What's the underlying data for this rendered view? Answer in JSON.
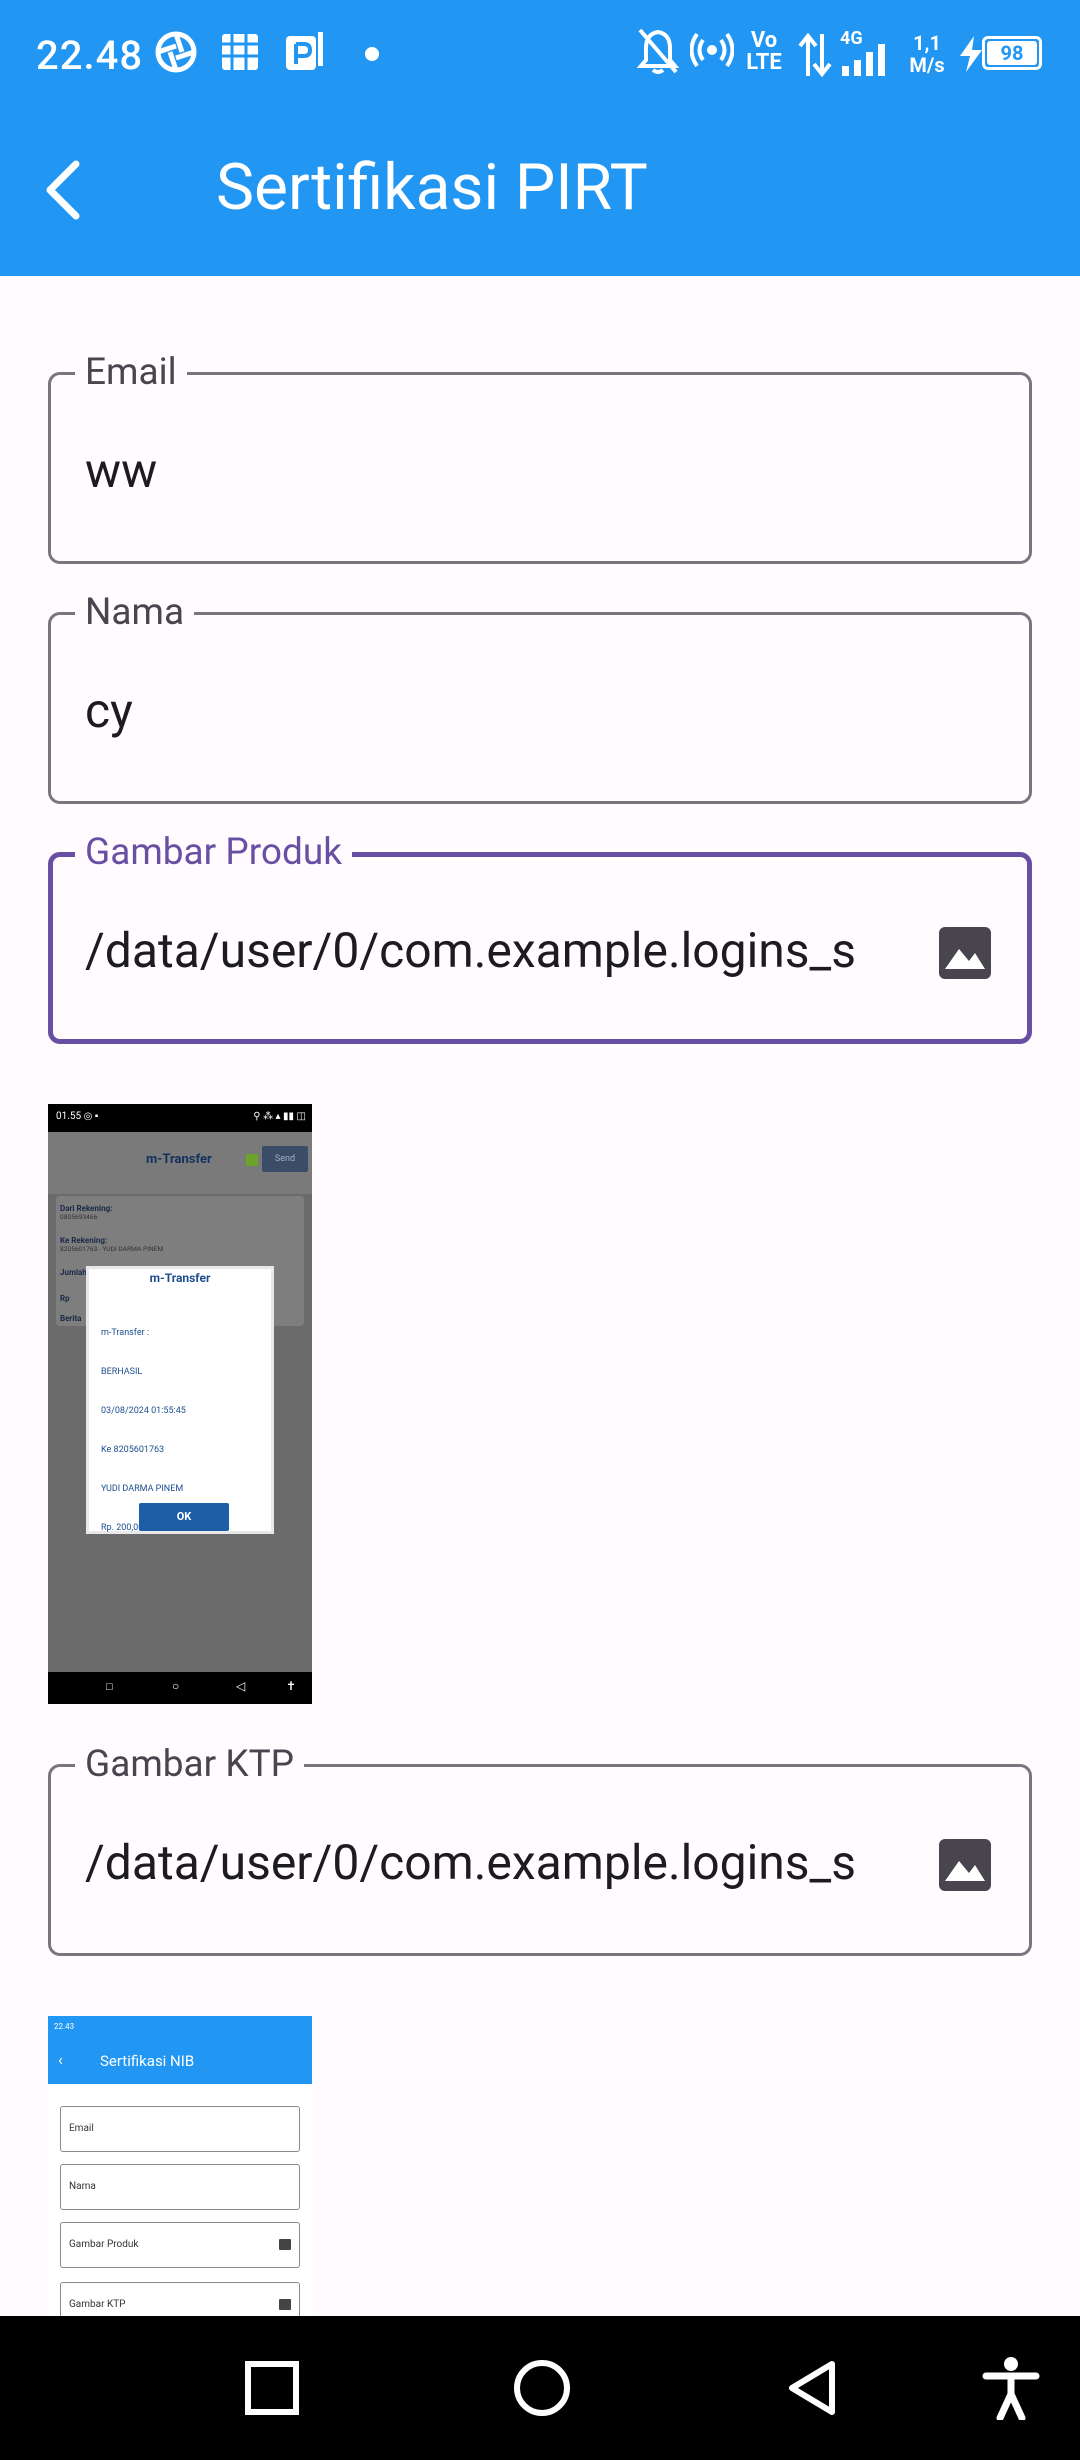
{
  "status_bar": {
    "time": "22.48",
    "icons": [
      "aperture-icon",
      "chip-icon",
      "parking-icon",
      "dot-icon",
      "bell-off-icon",
      "hotspot-icon",
      "volte-icon",
      "data-arrows-icon",
      "signal-4g-icon"
    ],
    "network_type": "4G",
    "speed": "1,1",
    "speed_unit": "M/s",
    "battery": "98"
  },
  "app_bar": {
    "title": "Sertifikasi PIRT",
    "back_icon": "arrow-back-icon"
  },
  "form": {
    "email": {
      "label": "Email",
      "value": "ww"
    },
    "nama": {
      "label": "Nama",
      "value": "cy"
    },
    "gambar_produk": {
      "label": "Gambar Produk",
      "value": "/data/user/0/com.example.logins_s",
      "icon": "image-icon"
    },
    "gambar_ktp": {
      "label": "Gambar KTP",
      "value": "/data/user/0/com.example.logins_s",
      "icon": "image-icon"
    }
  },
  "preview_produk": {
    "status_time": "01.55",
    "title": "m-Transfer",
    "send_label": "Send",
    "rows": [
      {
        "label": "Dari Rekening:",
        "value": "0805693466"
      },
      {
        "label": "Ke Rekening:",
        "value": "8205601763 - YUDI DARMA PINEM"
      },
      {
        "label": "Jumlah",
        "value": ""
      },
      {
        "label": "Rp",
        "value": ""
      },
      {
        "label": "Berita",
        "value": ""
      }
    ],
    "dialog_title": "m-Transfer",
    "dialog_lines": [
      "m-Transfer :",
      "BERHASIL",
      "03/08/2024 01:55:45",
      "Ke 8205601763",
      "YUDI DARMA PINEM",
      "Rp. 200,000.00"
    ],
    "ok_label": "OK"
  },
  "preview_ktp": {
    "status_time": "22.43",
    "title": "Sertifikasi NIB",
    "fields": [
      "Email",
      "Nama",
      "Gambar Produk",
      "Gambar KTP"
    ]
  },
  "nav_bar": {
    "items": [
      "recents-icon",
      "home-icon",
      "back-icon",
      "accessibility-icon"
    ]
  },
  "colors": {
    "primary": "#2196F3",
    "focus": "#6750A4",
    "outline": "#79747E",
    "background": "#FFFBFE"
  }
}
